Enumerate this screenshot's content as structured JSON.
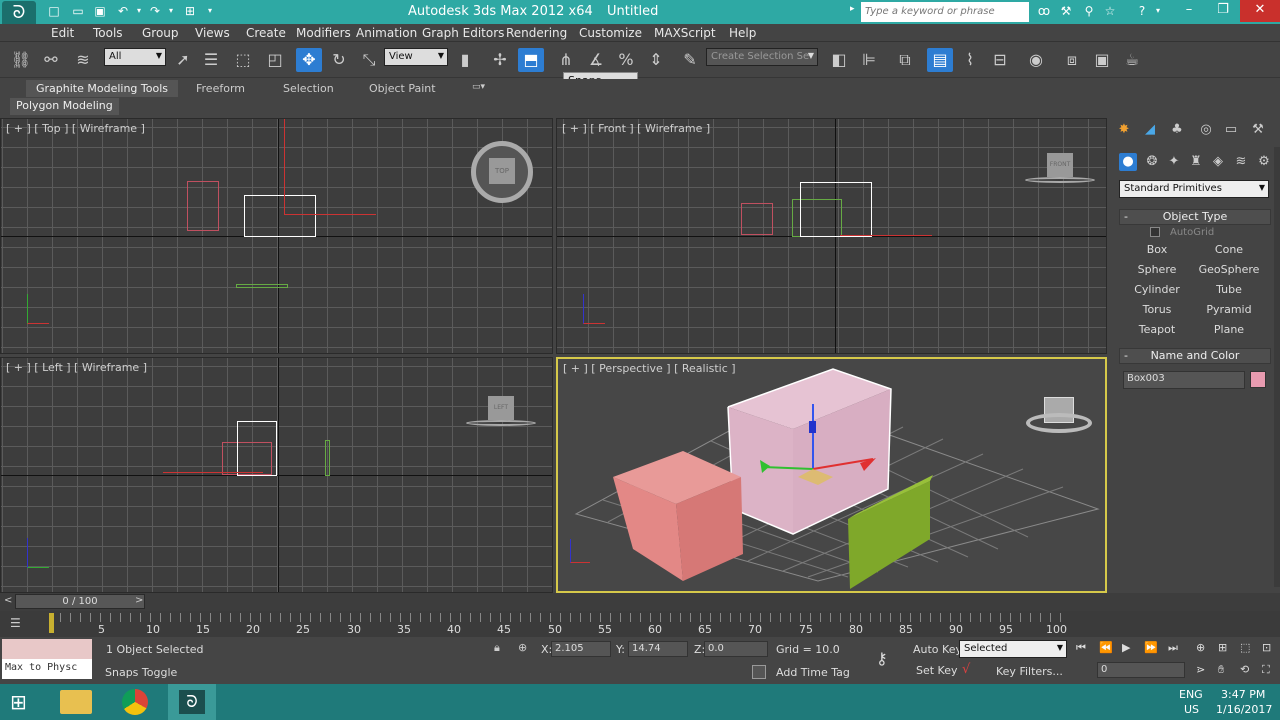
{
  "window": {
    "title": "Autodesk 3ds Max  2012 x64",
    "document": "Untitled",
    "search_placeholder": "Type a keyword or phrase"
  },
  "menu": [
    "Edit",
    "Tools",
    "Group",
    "Views",
    "Create",
    "Modifiers",
    "Animation",
    "Graph Editors",
    "Rendering",
    "Customize",
    "MAXScript",
    "Help"
  ],
  "toolbar": {
    "filter": "All",
    "refcoord": "View",
    "named_sel": "Create Selection Se"
  },
  "tooltip": "Snaps Toggle",
  "ribbon": {
    "tabs": [
      "Graphite Modeling Tools",
      "Freeform",
      "Selection",
      "Object Paint"
    ],
    "subtab": "Polygon Modeling"
  },
  "viewports": {
    "top": "[ + ] [ Top ] [ Wireframe ]",
    "front": "[ + ] [ Front ] [ Wireframe ]",
    "left": "[ + ] [ Left ] [ Wireframe ]",
    "persp": "[ + ] [ Perspective ] [ Realistic ]"
  },
  "viewcube": {
    "top": "TOP",
    "front": "FRONT",
    "left": "LEFT"
  },
  "command_panel": {
    "category": "Standard Primitives",
    "object_type_header": "Object Type",
    "autogrid": "AutoGrid",
    "primitives": [
      "Box",
      "Cone",
      "Sphere",
      "GeoSphere",
      "Cylinder",
      "Tube",
      "Torus",
      "Pyramid",
      "Teapot",
      "Plane"
    ],
    "name_color_header": "Name and Color",
    "object_name": "Box003",
    "object_color": "#e89bb0"
  },
  "timeline": {
    "frame": "0 / 100",
    "ticks": [
      "5",
      "10",
      "15",
      "20",
      "25",
      "30",
      "35",
      "40",
      "45",
      "50",
      "55",
      "60",
      "65",
      "70",
      "75",
      "80",
      "85",
      "90",
      "95",
      "100"
    ]
  },
  "status": {
    "script_listener": "Max to Physc",
    "selected": "1 Object Selected",
    "prompt": "Snaps Toggle",
    "x": "2.105",
    "y": "14.74",
    "z": "0.0",
    "xl": "X:",
    "yl": "Y:",
    "zl": "Z:",
    "grid": "Grid = 10.0",
    "add_time_tag": "Add Time Tag",
    "auto_key": "Auto Key",
    "set_key": "Set Key",
    "key_mode": "Selected",
    "key_filters": "Key Filters...",
    "frame_field": "0"
  },
  "taskbar": {
    "lang1": "ENG",
    "lang2": "US",
    "time": "3:47 PM",
    "date": "1/16/2017"
  }
}
